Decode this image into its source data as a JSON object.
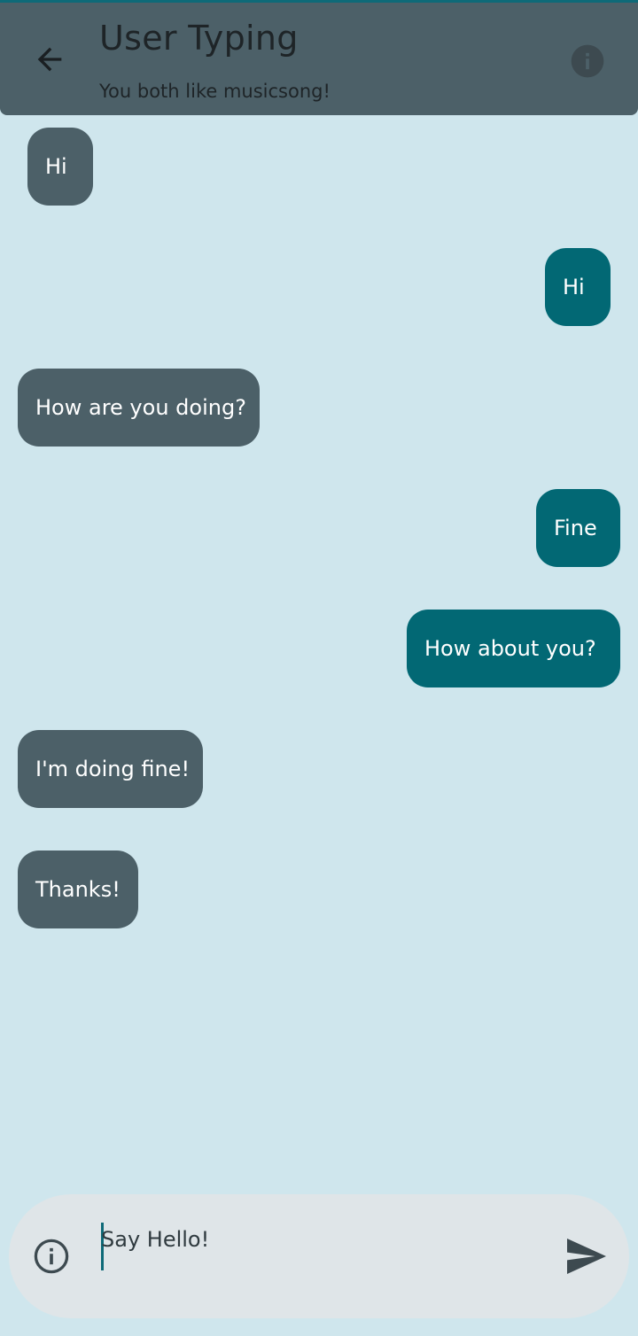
{
  "header": {
    "title": "User Typing",
    "subtitle": "You both like musicsong!",
    "back_icon": "arrow-left-icon",
    "info_icon": "info-icon"
  },
  "messages": [
    {
      "from": "them",
      "text": "Hi"
    },
    {
      "from": "me",
      "text": "Hi"
    },
    {
      "from": "them",
      "text": "How are you doing?"
    },
    {
      "from": "me",
      "text": "Fine"
    },
    {
      "from": "me",
      "text": "How about you?"
    },
    {
      "from": "them",
      "text": "I'm doing fine!"
    },
    {
      "from": "them",
      "text": "Thanks!"
    }
  ],
  "composer": {
    "placeholder": "Say Hello!",
    "value": "",
    "info_icon": "info-outline-icon",
    "send_icon": "send-icon"
  },
  "colors": {
    "background": "#cfe6ed",
    "header": "#4c6068",
    "incoming_bubble": "#4c6068",
    "outgoing_bubble": "#026874",
    "accent": "#0e6a78",
    "composer": "#dfe5e8"
  }
}
